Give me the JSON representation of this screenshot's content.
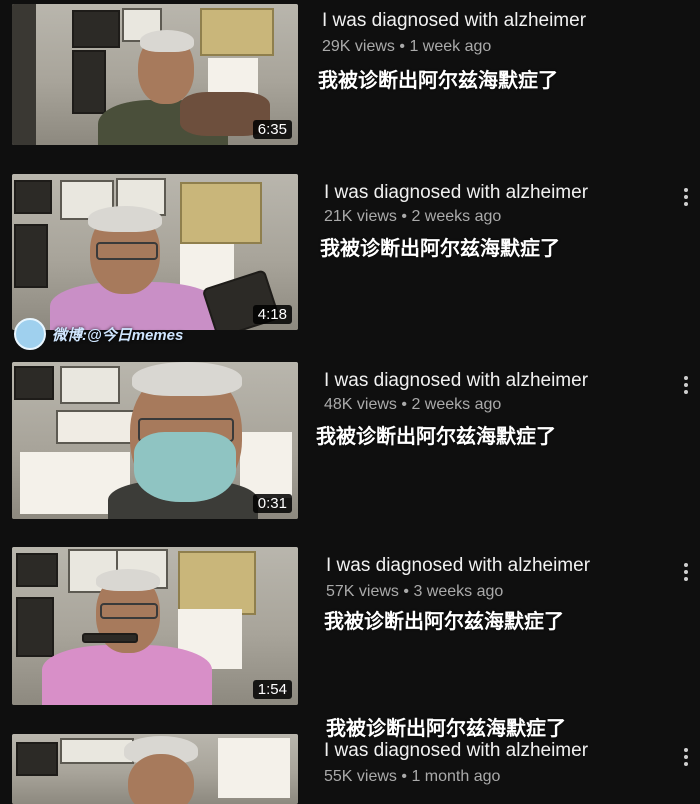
{
  "results": [
    {
      "title": "I was diagnosed with alzheimer",
      "views": "29K views",
      "age": "1 week ago",
      "duration": "6:35",
      "caption": "我被诊断出阿尔兹海默症了"
    },
    {
      "title": "I was diagnosed with alzheimer",
      "views": "21K views",
      "age": "2 weeks ago",
      "duration": "4:18",
      "caption": "我被诊断出阿尔兹海默症了"
    },
    {
      "title": "I was diagnosed with alzheimer",
      "views": "48K views",
      "age": "2 weeks ago",
      "duration": "0:31",
      "caption": "我被诊断出阿尔兹海默症了"
    },
    {
      "title": "I was diagnosed with alzheimer",
      "views": "57K views",
      "age": "3 weeks ago",
      "duration": "1:54",
      "caption": "我被诊断出阿尔兹海默症了"
    },
    {
      "title": "I was diagnosed with alzheimer",
      "views": "55K views",
      "age": "1 month ago",
      "caption": "我被诊断出阿尔兹海默症了"
    }
  ],
  "separator": "•",
  "watermark": "微博:@今日memes",
  "colors": {
    "background": "#0f0f0f",
    "title": "#f1f1f1",
    "meta": "#aaaaaa",
    "duration_bg": "#000000"
  }
}
